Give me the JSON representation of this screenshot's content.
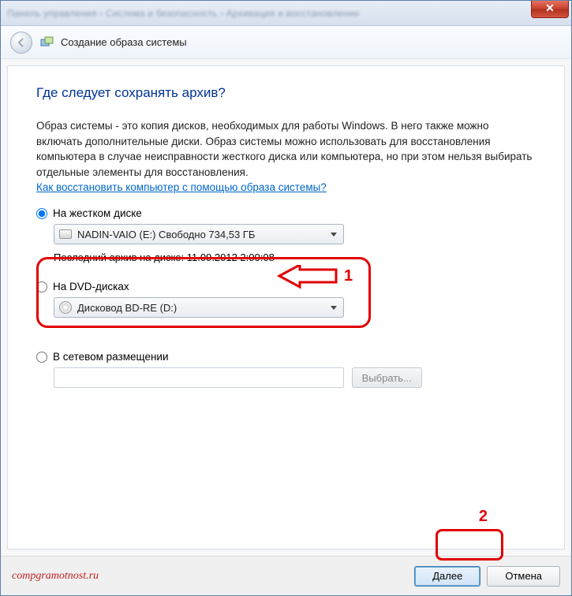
{
  "breadcrumb": "Панель управления › Система и безопасность › Архивация и восстановление",
  "close_x": "✕",
  "header_title": "Создание образа системы",
  "question": "Где следует сохранять архив?",
  "description": "Образ системы - это копия дисков, необходимых для работы Windows. В него также можно включать дополнительные диски. Образ системы можно использовать для восстановления компьютера в случае неисправности жесткого диска или компьютера, но при этом нельзя выбирать отдельные элементы для восстановления.",
  "help_link": "Как восстановить компьютер с помощью образа системы?",
  "options": {
    "hdd": {
      "label": "На жестком диске",
      "combo": "NADIN-VAIO (E:)  Свободно 734,53 ГБ",
      "last": "Последний архив на диске: 11.09.2012 2:00:08"
    },
    "dvd": {
      "label": "На DVD-дисках",
      "combo": "Дисковод BD-RE (D:)"
    },
    "network": {
      "label": "В сетевом размещении",
      "browse": "Выбрать..."
    }
  },
  "annotations": {
    "n1": "1",
    "n2": "2"
  },
  "buttons": {
    "next": "Далее",
    "cancel": "Отмена"
  },
  "watermark": "compgramotnost.ru"
}
